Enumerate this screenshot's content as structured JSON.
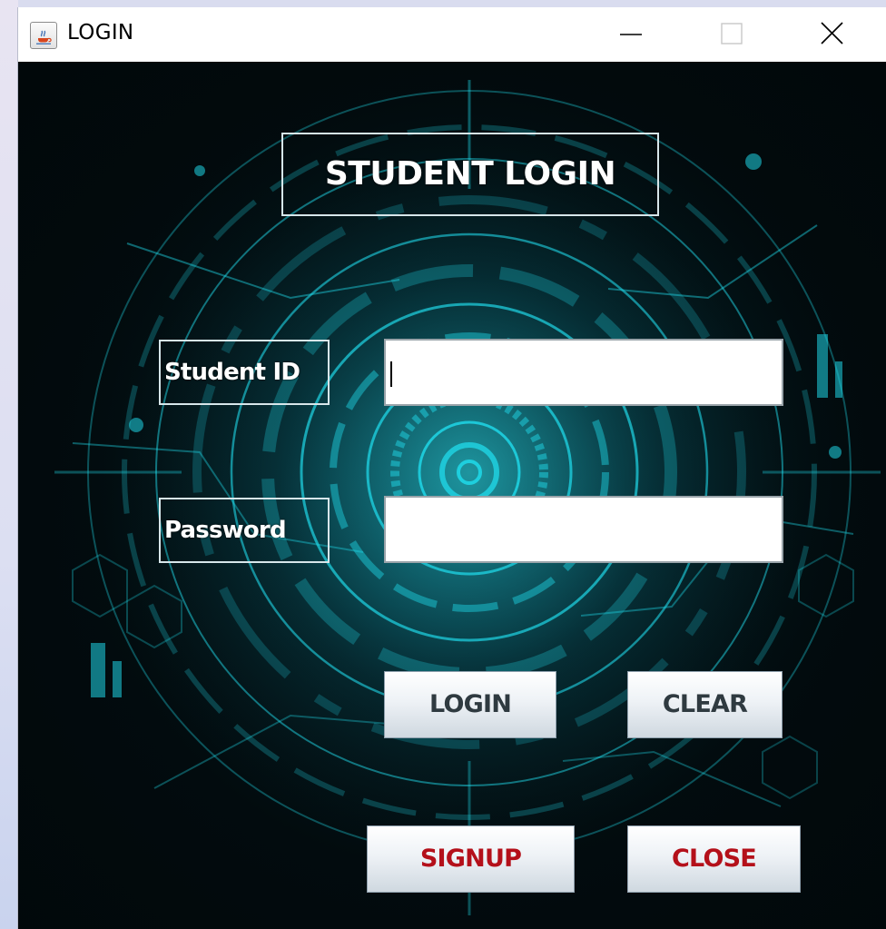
{
  "window": {
    "title": "LOGIN",
    "controls": {
      "minimize_icon": "minimize-icon",
      "maximize_icon": "maximize-icon",
      "close_icon": "close-icon"
    }
  },
  "form": {
    "heading": "STUDENT LOGIN",
    "student_id": {
      "label": "Student ID",
      "value": ""
    },
    "password": {
      "label": "Password",
      "value": ""
    }
  },
  "buttons": {
    "login": "LOGIN",
    "clear": "CLEAR",
    "signup": "SIGNUP",
    "close": "CLOSE"
  },
  "colors": {
    "background": "#020b0e",
    "accent_cyan": "#1fd6e6",
    "label_border": "#d7e6ea",
    "secondary_button_text": "#b4101a",
    "primary_button_text": "#2f3a40"
  }
}
